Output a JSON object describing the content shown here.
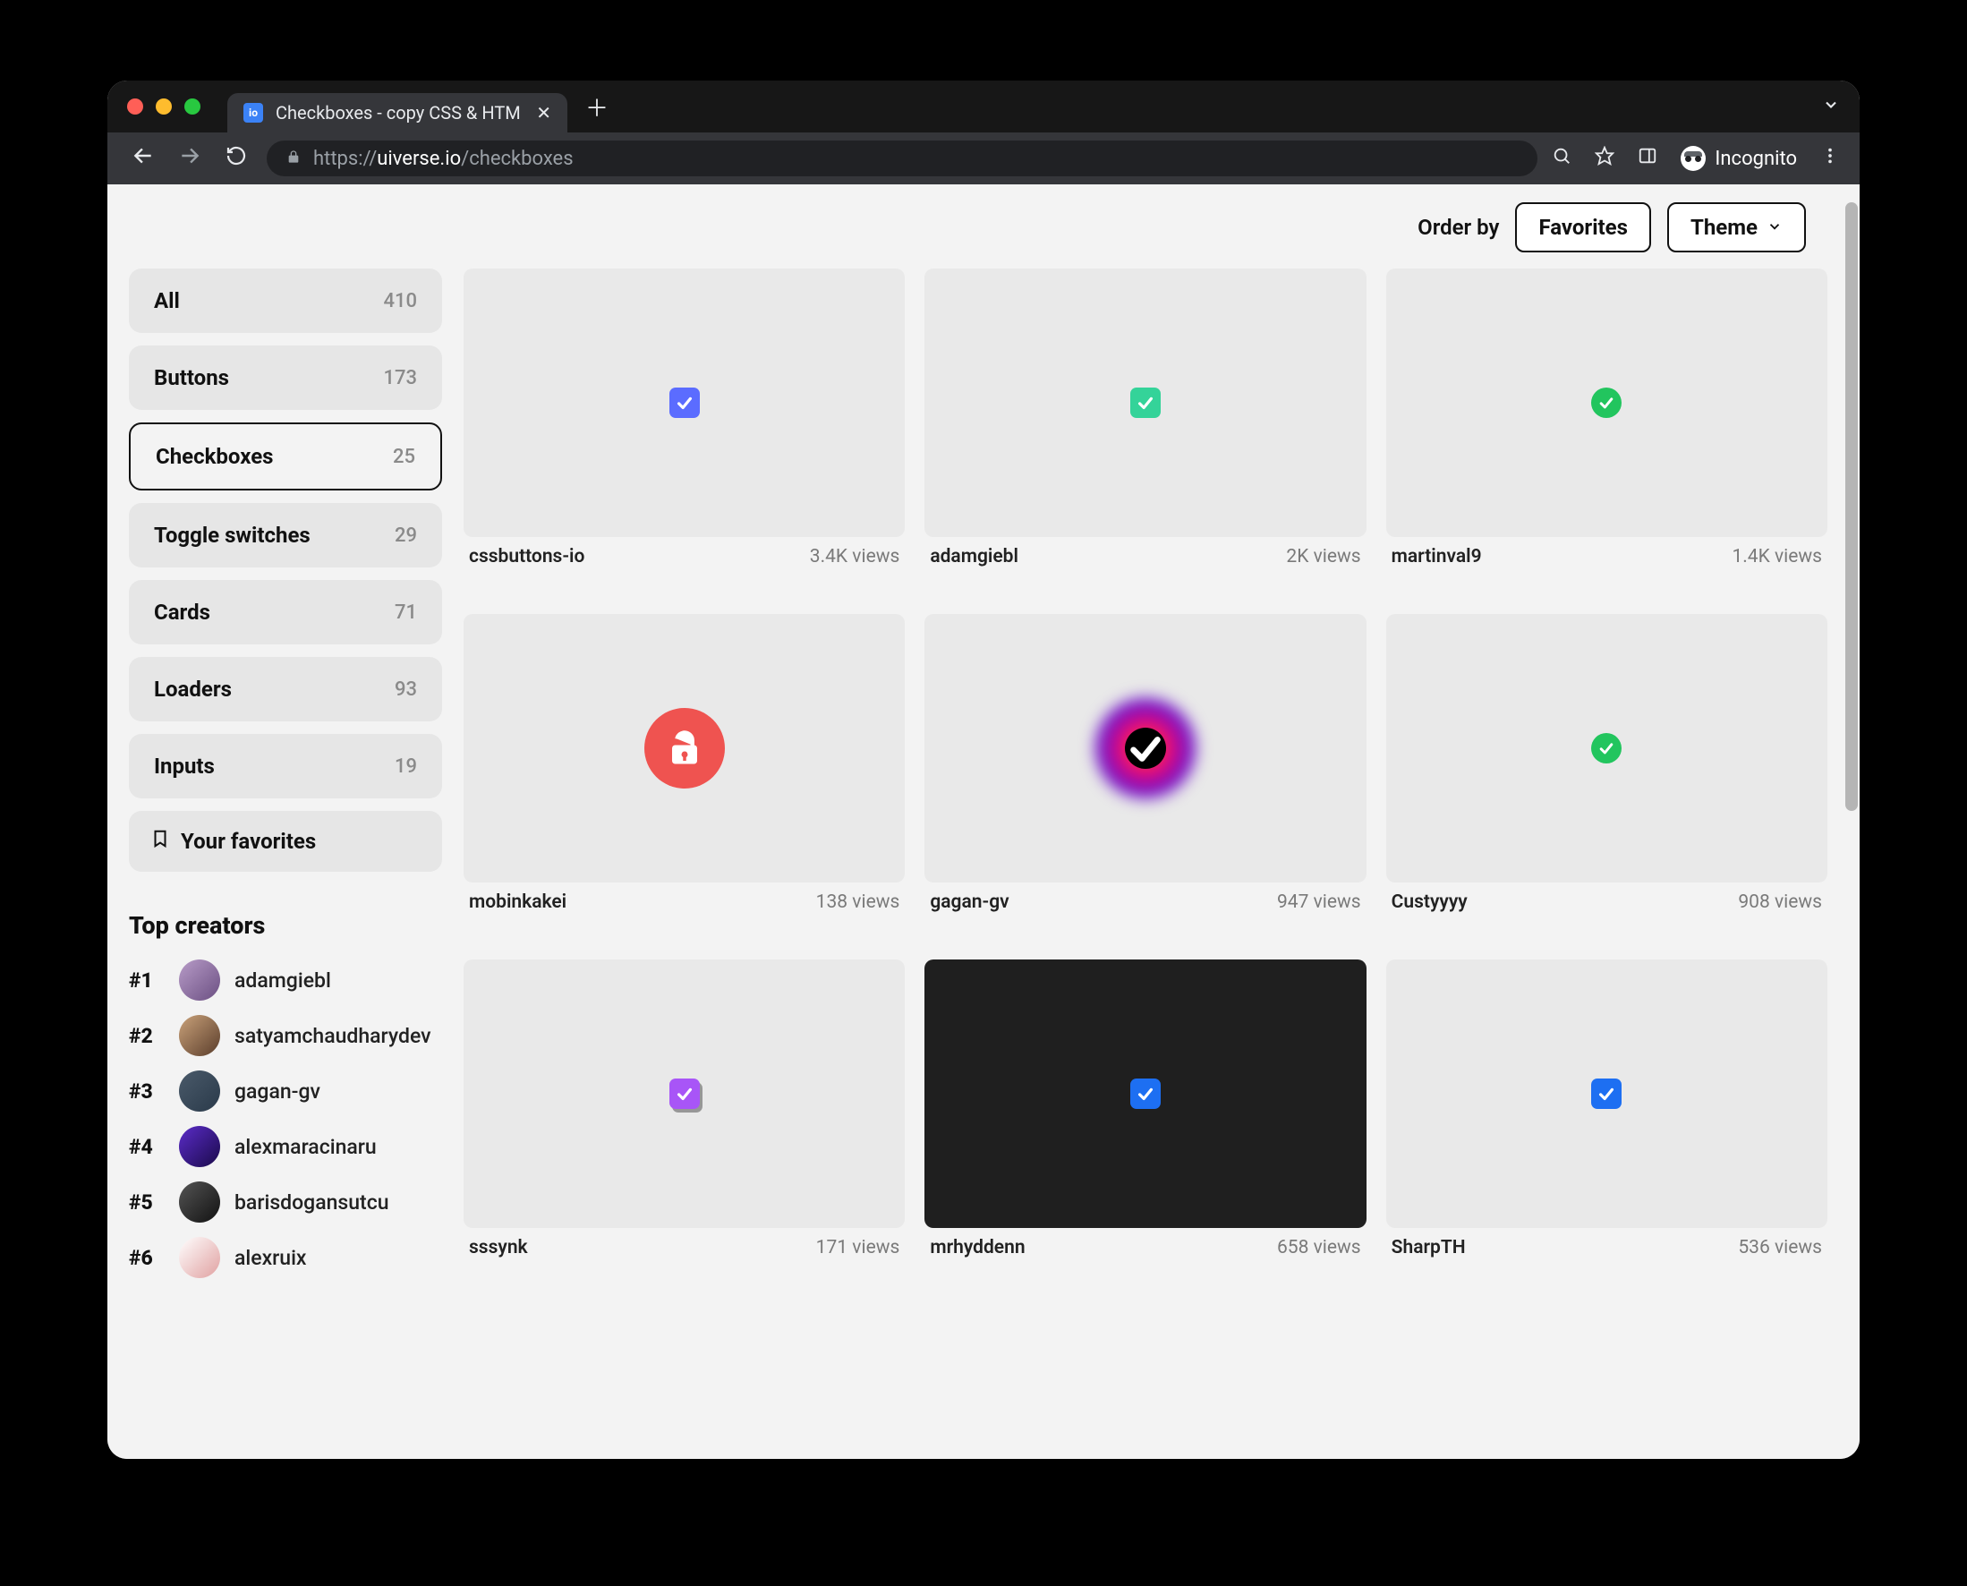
{
  "browser": {
    "tab_title": "Checkboxes - copy CSS & HTM",
    "favicon_text": "io",
    "url_scheme": "https://",
    "url_host": "uiverse.io",
    "url_path": "/checkboxes",
    "incognito_label": "Incognito"
  },
  "topbar": {
    "order_by_label": "Order by",
    "sort_button": "Favorites",
    "theme_button": "Theme"
  },
  "sidebar": {
    "items": [
      {
        "name": "All",
        "count": "410",
        "active": false
      },
      {
        "name": "Buttons",
        "count": "173",
        "active": false
      },
      {
        "name": "Checkboxes",
        "count": "25",
        "active": true
      },
      {
        "name": "Toggle switches",
        "count": "29",
        "active": false
      },
      {
        "name": "Cards",
        "count": "71",
        "active": false
      },
      {
        "name": "Loaders",
        "count": "93",
        "active": false
      },
      {
        "name": "Inputs",
        "count": "19",
        "active": false
      }
    ],
    "favorites_label": "Your favorites"
  },
  "top_creators": {
    "title": "Top creators",
    "list": [
      {
        "rank": "#1",
        "name": "adamgiebl"
      },
      {
        "rank": "#2",
        "name": "satyamchaudharydev"
      },
      {
        "rank": "#3",
        "name": "gagan-gv"
      },
      {
        "rank": "#4",
        "name": "alexmaracinaru"
      },
      {
        "rank": "#5",
        "name": "barisdogansutcu"
      },
      {
        "rank": "#6",
        "name": "alexruix"
      }
    ]
  },
  "cards": [
    {
      "author": "cssbuttons-io",
      "views": "3.4K views",
      "kind": "square",
      "color": "#5b6cff",
      "dark": false
    },
    {
      "author": "adamgiebl",
      "views": "2K views",
      "kind": "square",
      "color": "#34d399",
      "dark": false
    },
    {
      "author": "martinval9",
      "views": "1.4K views",
      "kind": "circle",
      "color": "#22c55e",
      "dark": false
    },
    {
      "author": "mobinkakei",
      "views": "138 views",
      "kind": "lock",
      "color": "#ef5350",
      "dark": false
    },
    {
      "author": "gagan-gv",
      "views": "947 views",
      "kind": "glow",
      "color": "#000000",
      "dark": false
    },
    {
      "author": "Custyyyy",
      "views": "908 views",
      "kind": "circle",
      "color": "#22c55e",
      "dark": false
    },
    {
      "author": "sssynk",
      "views": "171 views",
      "kind": "square-shadow",
      "color": "#a855f7",
      "dark": false
    },
    {
      "author": "mrhyddenn",
      "views": "658 views",
      "kind": "square",
      "color": "#1d6ff2",
      "dark": true
    },
    {
      "author": "SharpTH",
      "views": "536 views",
      "kind": "square",
      "color": "#1d6ff2",
      "dark": false
    }
  ]
}
